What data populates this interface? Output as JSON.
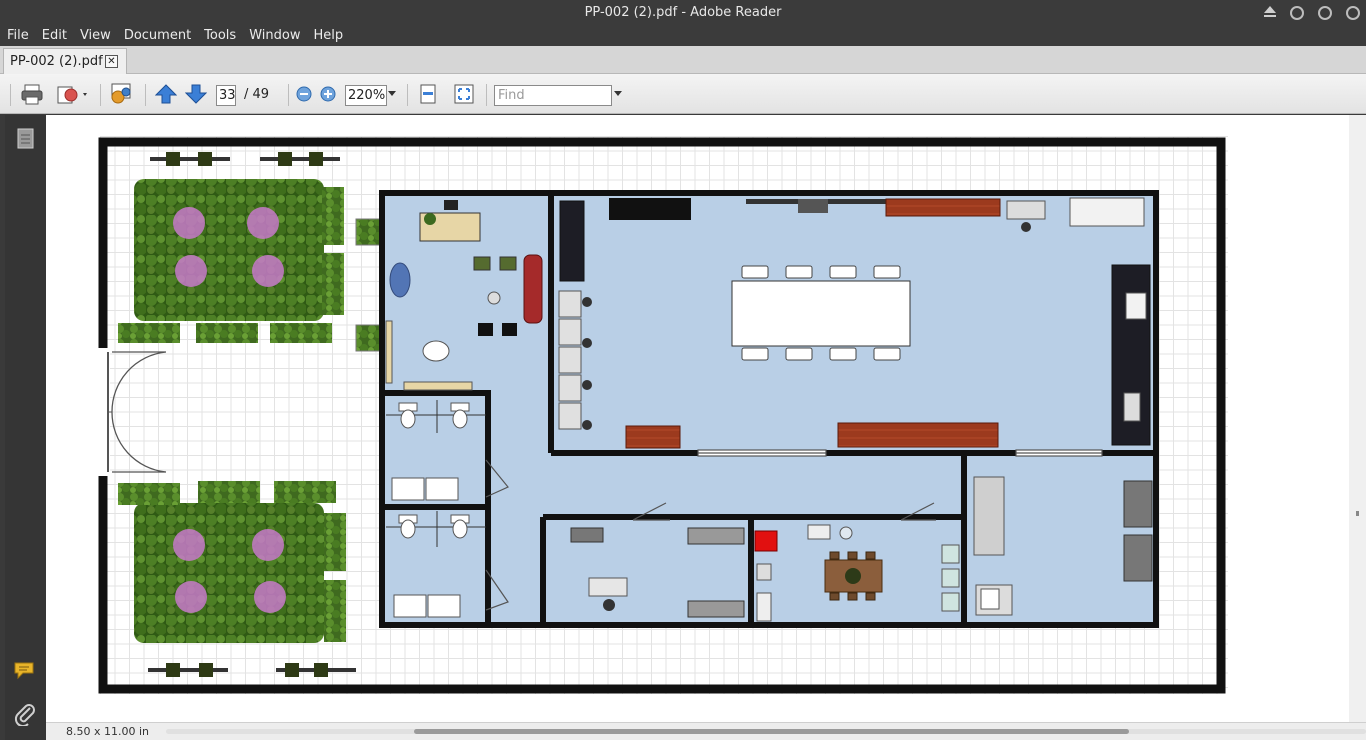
{
  "window": {
    "title": "PP-002 (2).pdf - Adobe Reader"
  },
  "menu": [
    "File",
    "Edit",
    "View",
    "Document",
    "Tools",
    "Window",
    "Help"
  ],
  "tab": {
    "label": "PP-002 (2).pdf",
    "close": "✕"
  },
  "toolbar": {
    "current_page": "33",
    "page_total": "/  49",
    "zoom": "220%",
    "find_placeholder": "Find"
  },
  "status": {
    "page_size": "8.50 x 11.00 in"
  },
  "colors": {
    "floor": "#b9cfe6",
    "wall": "#111111",
    "accent_red": "#e11010",
    "wood": "#9c3a1e"
  },
  "icons": [
    "print-icon",
    "share-icon",
    "network-icon",
    "arrow-up-icon",
    "arrow-down-icon",
    "zoom-out-icon",
    "zoom-in-icon",
    "fit-page-icon",
    "full-screen-icon",
    "pages-icon",
    "comment-icon",
    "attachment-icon"
  ]
}
